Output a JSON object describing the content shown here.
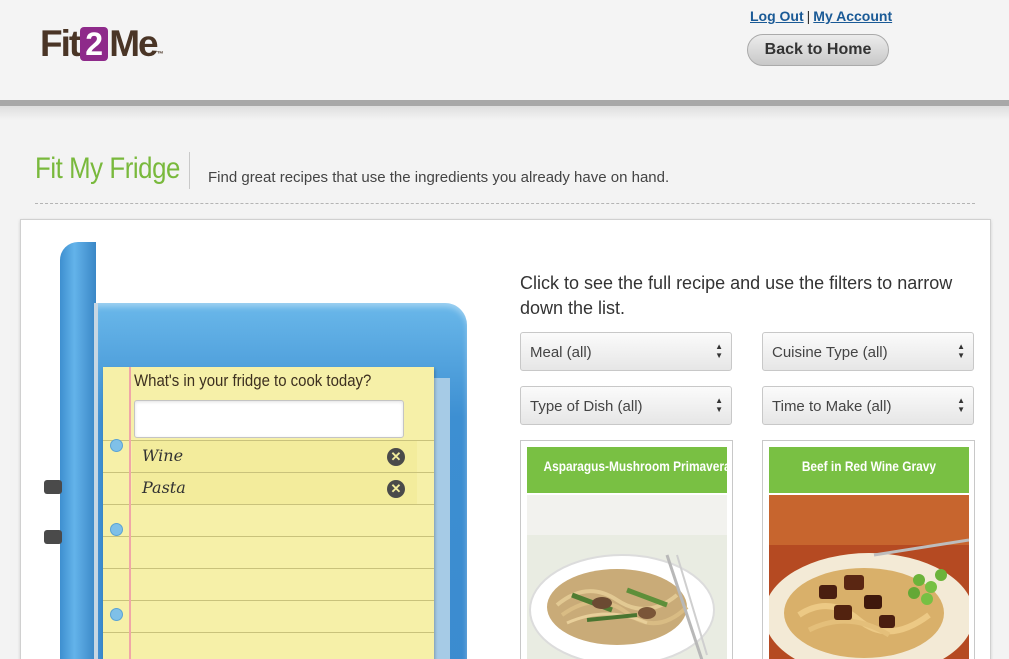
{
  "header": {
    "logo_text": "Fit2Me",
    "logout_label": "Log Out",
    "separator": "|",
    "account_label": "My Account",
    "back_home_label": "Back to Home"
  },
  "page": {
    "title": "Fit My Fridge",
    "subtitle": "Find great recipes that use the ingredients you already have on hand."
  },
  "fridge": {
    "prompt": "What's in your fridge to cook today?",
    "input_value": "",
    "ingredients": [
      {
        "name": "Wine"
      },
      {
        "name": "Pasta"
      }
    ]
  },
  "results": {
    "instructions": "Click to see the full recipe and use the filters to narrow down the list.",
    "filters": [
      {
        "label": "Meal (all)"
      },
      {
        "label": "Cuisine Type (all)"
      },
      {
        "label": "Type of Dish (all)"
      },
      {
        "label": "Time to Make (all)"
      }
    ],
    "recipes": [
      {
        "title": "Asparagus-Mushroom Primavera"
      },
      {
        "title": "Beef in Red Wine Gravy"
      }
    ]
  },
  "colors": {
    "brand_green": "#79b93c",
    "card_green": "#79c043",
    "logo_purple": "#8e2a8a",
    "fridge_blue": "#3d8fd2",
    "notepad_yellow": "#f6f0a8"
  }
}
